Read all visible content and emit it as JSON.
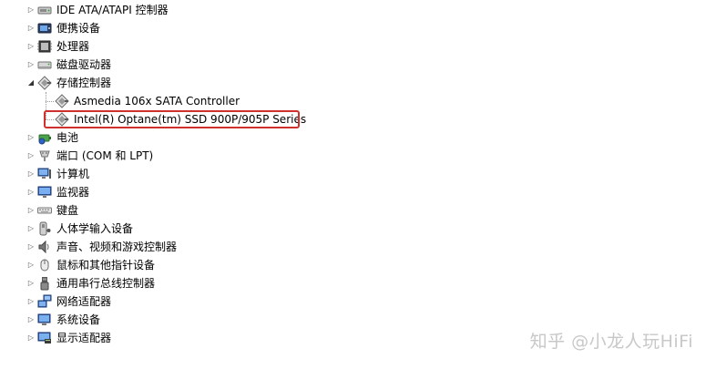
{
  "tree": {
    "items": [
      {
        "label": "IDE ATA/ATAPI 控制器",
        "icon": "ide-controller-icon",
        "expanded": false,
        "child": false
      },
      {
        "label": "便携设备",
        "icon": "portable-device-icon",
        "expanded": false,
        "child": false
      },
      {
        "label": "处理器",
        "icon": "processor-icon",
        "expanded": false,
        "child": false
      },
      {
        "label": "磁盘驱动器",
        "icon": "disk-drive-icon",
        "expanded": false,
        "child": false
      },
      {
        "label": "存储控制器",
        "icon": "storage-controller-icon",
        "expanded": true,
        "child": false
      },
      {
        "label": "Asmedia 106x SATA Controller",
        "icon": "storage-controller-icon",
        "expanded": false,
        "child": true
      },
      {
        "label": "Intel(R) Optane(tm) SSD 900P/905P Series",
        "icon": "storage-controller-icon",
        "expanded": false,
        "child": true,
        "highlighted": true
      },
      {
        "label": "电池",
        "icon": "battery-icon",
        "expanded": false,
        "child": false
      },
      {
        "label": "端口 (COM 和 LPT)",
        "icon": "port-icon",
        "expanded": false,
        "child": false
      },
      {
        "label": "计算机",
        "icon": "computer-icon",
        "expanded": false,
        "child": false
      },
      {
        "label": "监视器",
        "icon": "monitor-icon",
        "expanded": false,
        "child": false
      },
      {
        "label": "键盘",
        "icon": "keyboard-icon",
        "expanded": false,
        "child": false
      },
      {
        "label": "人体学输入设备",
        "icon": "hid-icon",
        "expanded": false,
        "child": false
      },
      {
        "label": "声音、视频和游戏控制器",
        "icon": "sound-icon",
        "expanded": false,
        "child": false
      },
      {
        "label": "鼠标和其他指针设备",
        "icon": "mouse-icon",
        "expanded": false,
        "child": false
      },
      {
        "label": "通用串行总线控制器",
        "icon": "usb-icon",
        "expanded": false,
        "child": false
      },
      {
        "label": "网络适配器",
        "icon": "network-adapter-icon",
        "expanded": false,
        "child": false
      },
      {
        "label": "系统设备",
        "icon": "system-device-icon",
        "expanded": false,
        "child": false
      },
      {
        "label": "显示适配器",
        "icon": "display-adapter-icon",
        "expanded": false,
        "child": false
      }
    ]
  },
  "watermark": "知乎 @小龙人玩HiFi",
  "colors": {
    "highlight_border": "#d0312d",
    "watermark": "#c8c8c8"
  }
}
